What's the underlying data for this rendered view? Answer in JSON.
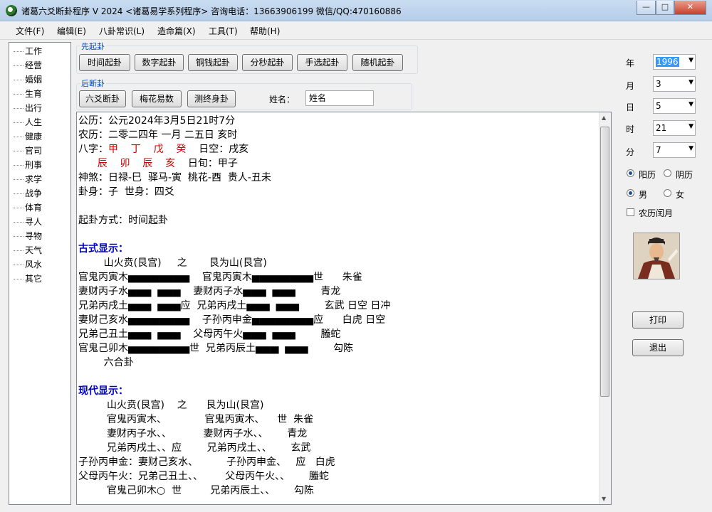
{
  "window": {
    "title": "诸葛六爻断卦程序 V 2024    <诸葛易学系列程序>  咨询电话：13663906199  微信/QQ:470160886",
    "min_label": "—",
    "max_label": "□",
    "close_label": "✕"
  },
  "menu": [
    "文件(F)",
    "编辑(E)",
    "八卦常识(L)",
    "造命篇(X)",
    "工具(T)",
    "帮助(H)"
  ],
  "tree": [
    "工作",
    "经营",
    "婚姻",
    "生育",
    "出行",
    "人生",
    "健康",
    "官司",
    "刑事",
    "求学",
    "战争",
    "体育",
    "寻人",
    "寻物",
    "天气",
    "风水",
    "其它"
  ],
  "group1": {
    "title": "先起卦",
    "buttons": [
      "时间起卦",
      "数字起卦",
      "铜钱起卦",
      "分秒起卦",
      "手选起卦",
      "随机起卦"
    ]
  },
  "group2": {
    "title": "后断卦",
    "buttons": [
      "六爻断卦",
      "梅花易数",
      "测终身卦"
    ],
    "name_label": "姓名：",
    "name_value": "姓名"
  },
  "right_panel": {
    "fields": [
      {
        "label": "年",
        "value": "1996",
        "selected": true
      },
      {
        "label": "月",
        "value": "3",
        "selected": false
      },
      {
        "label": "日",
        "value": "5",
        "selected": false
      },
      {
        "label": "时",
        "value": "21",
        "selected": false
      },
      {
        "label": "分",
        "value": "7",
        "selected": false
      }
    ],
    "calendar": {
      "solar": "阳历",
      "lunar": "阴历",
      "checked": "solar"
    },
    "gender": {
      "male": "男",
      "female": "女",
      "checked": "male"
    },
    "leap_month": "农历闰月",
    "print_button": "打印",
    "exit_button": "退出"
  },
  "content": {
    "lines": [
      [
        {
          "t": "公历：公元2024年3月5日21时7分"
        }
      ],
      [
        {
          "t": "农历：二零二四年 一月 二五日 亥时"
        }
      ],
      [
        {
          "t": "八字："
        },
        {
          "t": "甲    丁    戊    癸",
          "c": "red"
        },
        {
          "t": "    日空：戌亥"
        }
      ],
      [
        {
          "t": "      "
        },
        {
          "t": "辰    卯    辰    亥",
          "c": "red"
        },
        {
          "t": "    日旬：甲子"
        }
      ],
      [
        {
          "t": "神煞：日禄-巳  驿马-寅  桃花-酉  贵人-丑未"
        }
      ],
      [
        {
          "t": "卦身：子  世身：四爻"
        }
      ],
      [
        {
          "t": ""
        }
      ],
      [
        {
          "t": "起卦方式：时间起卦"
        }
      ],
      [
        {
          "t": ""
        }
      ],
      [
        {
          "t": "古式显示：",
          "c": "blue-bold"
        }
      ],
      [
        {
          "t": "        山火贲(艮宫)     之       艮为山(艮宫)"
        }
      ],
      [
        {
          "t": "官鬼丙寅木▅▅▅▅▅▅▅▅    官鬼丙寅木▅▅▅▅▅▅▅▅世      朱雀"
        }
      ],
      [
        {
          "t": "妻财丙子水▅▅▅  ▅▅▅    妻财丙子水▅▅▅  ▅▅▅        青龙"
        }
      ],
      [
        {
          "t": "兄弟丙戌土▅▅▅  ▅▅▅应  兄弟丙戌土▅▅▅  ▅▅▅        玄武 日空 日冲"
        }
      ],
      [
        {
          "t": "妻财己亥水▅▅▅▅▅▅▅▅    子孙丙申金▅▅▅▅▅▅▅▅应      白虎 日空"
        }
      ],
      [
        {
          "t": "兄弟己丑土▅▅▅  ▅▅▅    父母丙午火▅▅▅  ▅▅▅        螣蛇"
        }
      ],
      [
        {
          "t": "官鬼己卯木▅▅▅▅▅▅▅▅世  兄弟丙辰土▅▅▅  ▅▅▅        勾陈"
        }
      ],
      [
        {
          "t": "        六合卦"
        }
      ],
      [
        {
          "t": ""
        }
      ],
      [
        {
          "t": "现代显示：",
          "c": "blue-bold"
        }
      ],
      [
        {
          "t": "         山火贲(艮宫)    之      艮为山(艮宫)"
        }
      ],
      [
        {
          "t": "         官鬼丙寅木、            官鬼丙寅木、    世  朱雀"
        }
      ],
      [
        {
          "t": "         妻财丙子水、、          妻财丙子水、、      青龙"
        }
      ],
      [
        {
          "t": "         兄弟丙戌土、、应        兄弟丙戌土、、      玄武"
        }
      ],
      [
        {
          "t": "子孙丙申金：妻财己亥水、         子孙丙申金、   应   白虎"
        }
      ],
      [
        {
          "t": "父母丙午火：兄弟己丑土、、       父母丙午火、、      螣蛇"
        }
      ],
      [
        {
          "t": "         官鬼己卯木○  世         兄弟丙辰土、、      勾陈"
        }
      ]
    ]
  }
}
